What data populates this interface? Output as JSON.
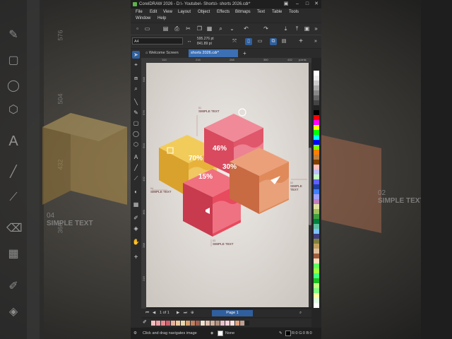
{
  "backdrop": {
    "ruler_labels": [
      "576",
      "504",
      "432",
      "360"
    ],
    "left_label": "04",
    "left_text": "SIMPLE TEXT",
    "right_label": "02",
    "right_text": "SIMPLE TEXT"
  },
  "window": {
    "title": "CorelDRAW 2026 - D:\\- Youtube\\- Shorts\\- shorts 2026.cdr*"
  },
  "menu": {
    "row1": [
      "File",
      "Edit",
      "View",
      "Layout",
      "Object",
      "Effects",
      "Bitmaps",
      "Text",
      "Table",
      "Tools"
    ],
    "row2": [
      "Window",
      "Help"
    ]
  },
  "properties": {
    "page_size": "A4",
    "width": "595.276 pt",
    "height": "841.89 pt"
  },
  "tabs": {
    "welcome": "Welcome Screen",
    "document": "shorts 2026.cdr*",
    "add": "+"
  },
  "rulers": {
    "top": [
      "144",
      "216",
      "288",
      "360",
      "432"
    ],
    "top_unit": "points",
    "left": [
      "648",
      "576",
      "504",
      "432",
      "360",
      "288",
      "216"
    ]
  },
  "artwork": {
    "cubes": [
      {
        "id": "01",
        "percent": "70%",
        "color": "#e8b23a"
      },
      {
        "id": "02",
        "percent": "46%",
        "color": "#e0566a"
      },
      {
        "id": "03",
        "percent": "15%",
        "color": "#e84a5e"
      },
      {
        "id": "04",
        "percent": "30%",
        "color": "#e08a5a"
      }
    ],
    "notes": [
      {
        "num": "01",
        "title": "SIMPLE TEXT"
      },
      {
        "num": "02",
        "title": "SIMPLE TEXT"
      },
      {
        "num": "04",
        "title": "SIMPLE TEXT"
      },
      {
        "num": "03",
        "title": "SIMPLE TEXT"
      }
    ]
  },
  "pagebar": {
    "counter": "1 of 1",
    "page_tab": "Page 1"
  },
  "status": {
    "hint": "Click and drag navigates image",
    "fill": "None",
    "color_readout": "R:0 G:0 B:0 (#000"
  },
  "colors": {
    "accent": "#3c6fb3",
    "canvas": "#d9d4cf"
  }
}
